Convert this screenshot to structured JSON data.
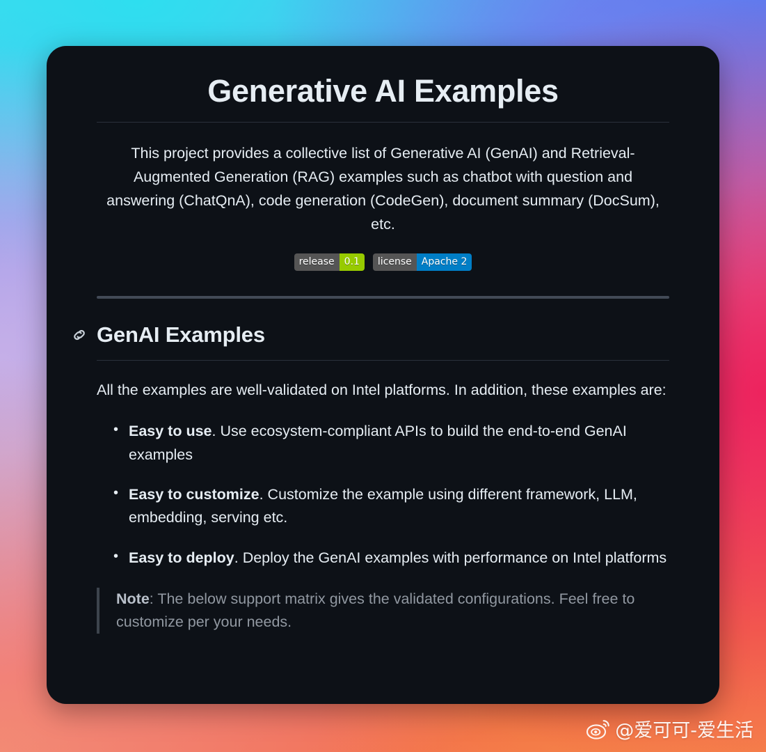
{
  "background": {
    "gradient_colors": [
      "#4fd8ee",
      "#5f7aee",
      "#c7b0e8",
      "#ed205c",
      "#f2673f",
      "#f2884e"
    ]
  },
  "card": {
    "background_color": "#0d1117",
    "title": "Generative AI Examples",
    "intro": "This project provides a collective list of Generative AI (GenAI) and Retrieval-Augmented Generation (RAG) examples such as chatbot with question and answering (ChatQnA), code generation (CodeGen), document summary (DocSum), etc.",
    "badges": [
      {
        "name": "release-badge",
        "label": "release",
        "value": "0.1",
        "label_color": "#555555",
        "value_color": "#97ca00"
      },
      {
        "name": "license-badge",
        "label": "license",
        "value": "Apache 2",
        "label_color": "#555555",
        "value_color": "#007ec6"
      }
    ],
    "section": {
      "anchor_icon": "link-icon",
      "heading": "GenAI Examples",
      "lead": "All the examples are well-validated on Intel platforms. In addition, these examples are:",
      "features": [
        {
          "term": "Easy to use",
          "desc": ". Use ecosystem-compliant APIs to build the end-to-end GenAI examples"
        },
        {
          "term": "Easy to customize",
          "desc": ". Customize the example using different framework, LLM, embedding, serving etc."
        },
        {
          "term": "Easy to deploy",
          "desc": ". Deploy the GenAI examples with performance on Intel platforms"
        }
      ],
      "note": {
        "term": "Note",
        "desc": ": The below support matrix gives the validated configurations. Feel free to customize per your needs."
      }
    }
  },
  "watermark": {
    "icon": "weibo-icon",
    "handle": "@爱可可-爱生活"
  }
}
